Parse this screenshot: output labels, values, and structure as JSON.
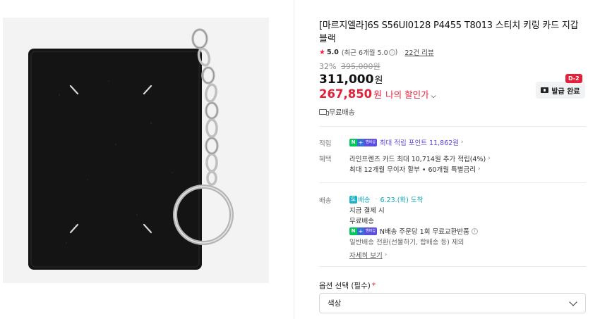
{
  "product": {
    "title": "[마르지엘라]6S S56UI0128 P4455 T8013 스티치 키링 카드 지갑 블랙",
    "image_icon": "wallet-keyring-image"
  },
  "rating": {
    "score": "5.0",
    "recent": "(최근 6개월 5.0",
    "recent_close": ")",
    "review_link": "22건 리뷰"
  },
  "price": {
    "discount_rate": "32%",
    "original": "395,000원",
    "sale": "311,000",
    "sale_unit": "원",
    "my_price": "267,850",
    "my_price_unit": "원",
    "my_price_label": "나의 할인가"
  },
  "coupon": {
    "badge": "D-2",
    "button_label": "발급 완료"
  },
  "shipping_free": "무료배송",
  "benefits": {
    "point_label": "적립",
    "point_badge_n": "N",
    "point_badge_plus": "+",
    "point_badge_mem": "멤버십",
    "point_text": "최대 적립 포인트 11,862원",
    "benefit_label": "혜택",
    "card_text": "라인프렌즈 카드 최대 10,714원 추가 적립(4%)",
    "install_text": "최대 12개월 무이자 할부 • 60개월 특별금리"
  },
  "delivery": {
    "label": "배송",
    "badge_short": "도",
    "badge_text": "배송",
    "date": "6.23.(화) 도착",
    "line2": "지금 결제 시",
    "line3": "무료배송",
    "exchange_text": "N배송 주문당 1회 무료교환반품",
    "exclusion": "일반배송 전환(선물하기, 합배송 등) 제외",
    "more": "자세히 보기"
  },
  "options": {
    "label": "옵션 선택 (필수)",
    "required_mark": "*",
    "select_value": "색상"
  }
}
